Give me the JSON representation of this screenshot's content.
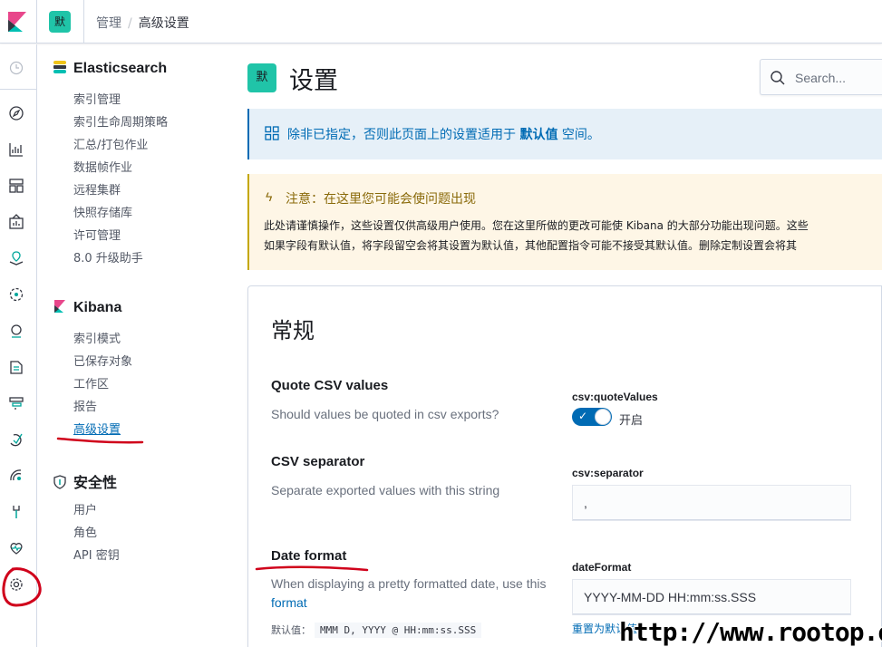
{
  "header": {
    "space_badge": "默",
    "breadcrumbs": [
      "管理",
      "高级设置"
    ]
  },
  "icon_nav": [
    "clock-icon",
    "compass-icon",
    "visualize-icon",
    "dashboard-icon",
    "canvas-icon",
    "maps-icon",
    "ml-icon",
    "infra-icon",
    "logs-icon",
    "apm-icon",
    "uptime-icon",
    "siem-icon",
    "dev-tools-icon",
    "monitoring-icon",
    "management-gear-icon"
  ],
  "sidebar": {
    "elasticsearch": {
      "title": "Elasticsearch",
      "items": [
        "索引管理",
        "索引生命周期策略",
        "汇总/打包作业",
        "数据帧作业",
        "远程集群",
        "快照存储库",
        "许可管理",
        "8.0 升级助手"
      ]
    },
    "kibana": {
      "title": "Kibana",
      "items": [
        "索引模式",
        "已保存对象",
        "工作区",
        "报告",
        "高级设置"
      ],
      "active_index": 4
    },
    "security": {
      "title": "安全性",
      "items": [
        "用户",
        "角色",
        "API 密钥"
      ]
    }
  },
  "page": {
    "badge": "默",
    "title": "设置",
    "search_placeholder": "Search..."
  },
  "info_callout": {
    "text_before": "除非已指定，否则此页面上的设置适用于",
    "space_name": "默认值",
    "text_after": "空间。"
  },
  "warning_callout": {
    "title": "注意：在这里您可能会使问题出现",
    "line1": "此处请谨慎操作，这些设置仅供高级用户使用。您在这里所做的更改可能使 Kibana 的大部分功能出现问题。这些",
    "line2": "如果字段有默认值，将字段留空会将其设置为默认值，其他配置指令可能不接受其默认值。删除定制设置会将其"
  },
  "panel": {
    "title": "常规",
    "settings": [
      {
        "title": "Quote CSV values",
        "description": "Should values be quoted in csv exports?",
        "key": "csv:quoteValues",
        "toggle_on": true,
        "toggle_label": "开启"
      },
      {
        "title": "CSV separator",
        "description": "Separate exported values with this string",
        "key": "csv:separator",
        "value": ","
      },
      {
        "title": "Date format",
        "description": "When displaying a pretty formatted date, use this",
        "description_link": "format",
        "key": "dateFormat",
        "value": "YYYY-MM-DD HH:mm:ss.SSS",
        "default_label": "默认值：",
        "default_value": "MMM D, YYYY @ HH:mm:ss.SSS",
        "reset_link": "重置为默认值"
      }
    ]
  },
  "watermark": "http://www.rootop.org",
  "colors": {
    "accent": "#006bb4",
    "space_badge": "#20c4a8",
    "annotation_red": "#d0021b"
  }
}
